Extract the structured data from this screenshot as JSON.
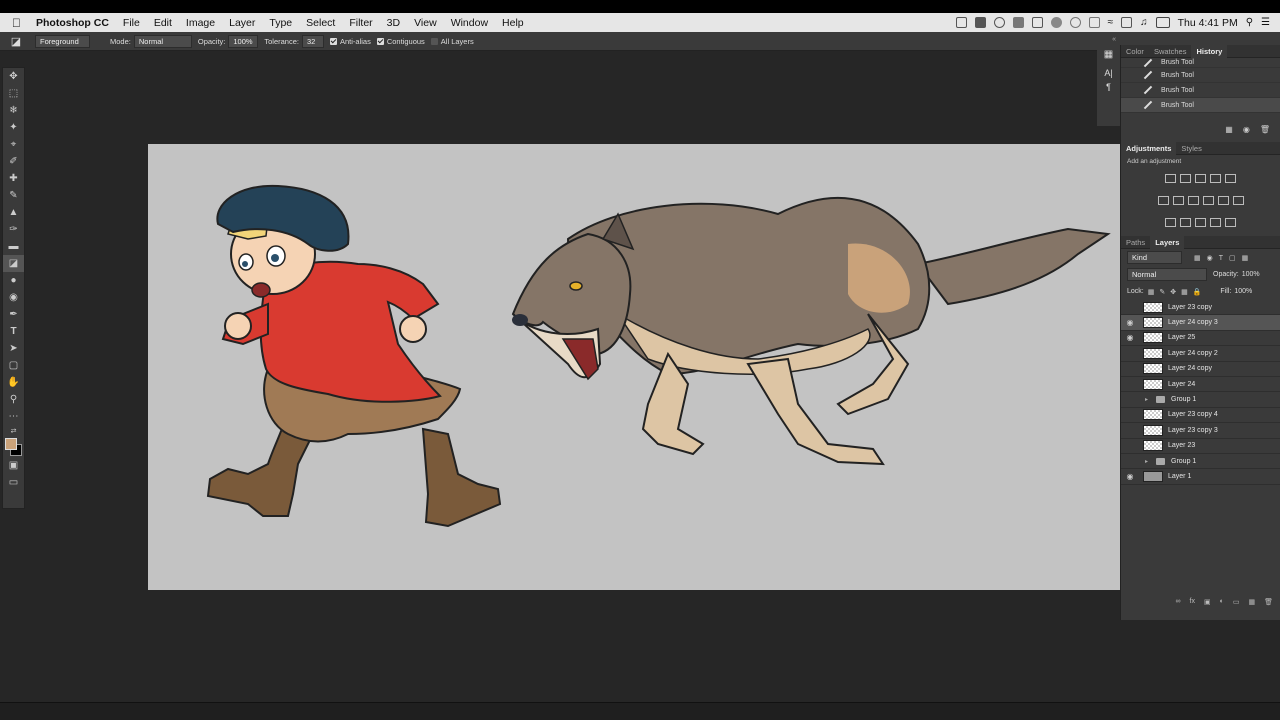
{
  "menubar": {
    "app": "Photoshop CC",
    "items": [
      "File",
      "Edit",
      "Image",
      "Layer",
      "Type",
      "Select",
      "Filter",
      "3D",
      "View",
      "Window",
      "Help"
    ],
    "clock": "Thu 4:41 PM"
  },
  "options": {
    "fill_source": "Foreground",
    "mode_label": "Mode:",
    "mode_value": "Normal",
    "opacity_label": "Opacity:",
    "opacity_value": "100%",
    "tolerance_label": "Tolerance:",
    "tolerance_value": "32",
    "antialias": "Anti-alias",
    "contiguous": "Contiguous",
    "all_layers": "All Layers"
  },
  "history_panel": {
    "tabs": [
      "Color",
      "Swatches",
      "History"
    ],
    "active_tab": "History",
    "items": [
      "Brush Tool",
      "Brush Tool",
      "Brush Tool",
      "Brush Tool"
    ]
  },
  "adjustments_panel": {
    "tabs": [
      "Adjustments",
      "Styles"
    ],
    "hint": "Add an adjustment"
  },
  "layers_panel": {
    "tabs": [
      "Paths",
      "Layers"
    ],
    "filter": "Kind",
    "blend_mode": "Normal",
    "opacity_label": "Opacity:",
    "opacity": "100%",
    "lock_label": "Lock:",
    "fill_label": "Fill:",
    "fill": "100%",
    "layers": [
      {
        "name": "Layer 23 copy",
        "visible": false,
        "type": "layer"
      },
      {
        "name": "Layer 24 copy 3",
        "visible": true,
        "type": "layer",
        "selected": true
      },
      {
        "name": "Layer 25",
        "visible": true,
        "type": "layer"
      },
      {
        "name": "Layer 24 copy 2",
        "visible": false,
        "type": "layer"
      },
      {
        "name": "Layer 24 copy",
        "visible": false,
        "type": "layer"
      },
      {
        "name": "Layer 24",
        "visible": false,
        "type": "layer"
      },
      {
        "name": "Group 1",
        "visible": false,
        "type": "group"
      },
      {
        "name": "Layer 23 copy 4",
        "visible": false,
        "type": "layer"
      },
      {
        "name": "Layer 23 copy 3",
        "visible": false,
        "type": "layer"
      },
      {
        "name": "Layer 23",
        "visible": false,
        "type": "layer"
      },
      {
        "name": "Group 1",
        "visible": false,
        "type": "group"
      },
      {
        "name": "Layer 1",
        "visible": true,
        "type": "solid"
      }
    ]
  },
  "colors": {
    "foreground": "#c9a27a",
    "background": "#000000"
  }
}
